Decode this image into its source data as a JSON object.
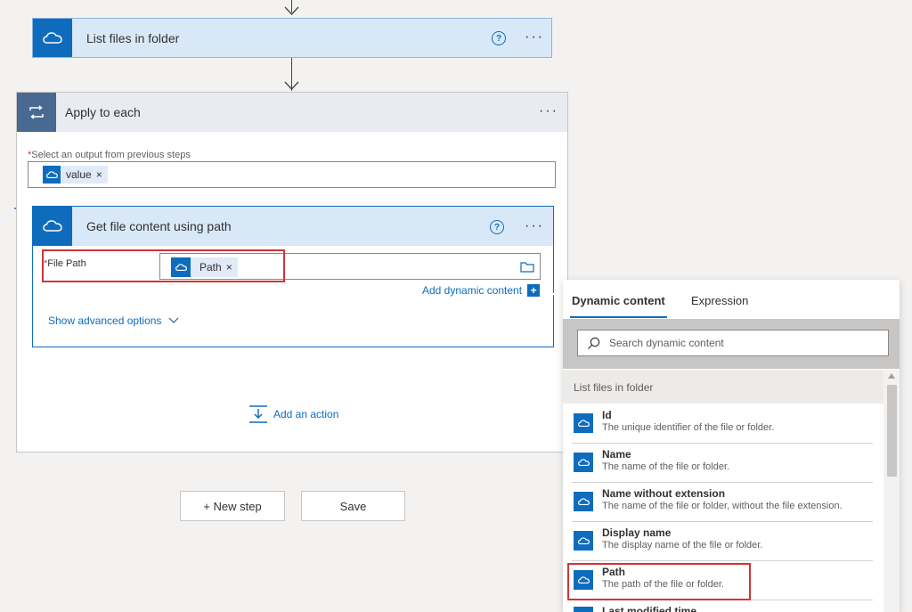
{
  "steps": {
    "list_files": {
      "title": "List files in folder",
      "help": "?",
      "more": "···"
    },
    "apply_each": {
      "title": "Apply to each",
      "more": "···",
      "required_mark": "*",
      "output_label": "Select an output from previous steps",
      "token_value": "value",
      "token_remove": "×"
    },
    "get_file": {
      "title": "Get file content using path",
      "help": "?",
      "more": "···",
      "required_mark": "*",
      "file_path_label": "File Path",
      "path_token": "Path",
      "token_remove": "×",
      "add_dynamic": "Add dynamic content",
      "add_dynamic_plus": "+",
      "show_advanced": "Show advanced options"
    },
    "add_action": "Add an action"
  },
  "buttons": {
    "new_step": "+ New step",
    "save": "Save"
  },
  "dynamic_panel": {
    "tabs": [
      "Dynamic content",
      "Expression"
    ],
    "search_placeholder": "Search dynamic content",
    "section": "List files in folder",
    "items": [
      {
        "name": "Id",
        "desc": "The unique identifier of the file or folder."
      },
      {
        "name": "Name",
        "desc": "The name of the file or folder."
      },
      {
        "name": "Name without extension",
        "desc": "The name of the file or folder, without the file extension."
      },
      {
        "name": "Display name",
        "desc": "The display name of the file or folder."
      },
      {
        "name": "Path",
        "desc": "The path of the file or folder."
      },
      {
        "name": "Last modified time",
        "desc": ""
      }
    ]
  },
  "colors": {
    "accent": "#0f6cbd",
    "loop_accent": "#486991",
    "header_blue": "#d9e8f7",
    "highlight": "#d13438"
  }
}
